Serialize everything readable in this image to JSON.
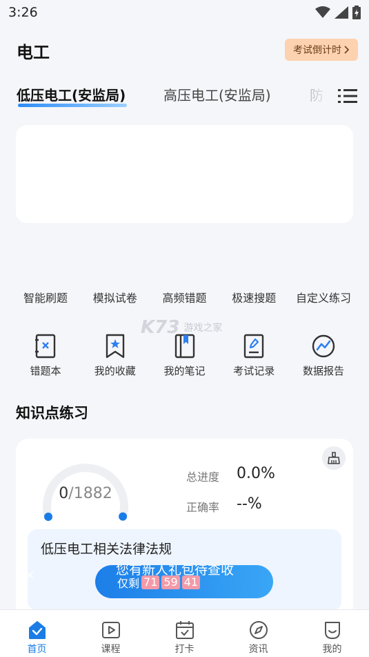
{
  "status_bar": {
    "time": "3:26"
  },
  "header": {
    "title": "电工",
    "countdown_label": "考试倒计时"
  },
  "tabs": [
    {
      "label": "低压电工(安监局)",
      "active": true
    },
    {
      "label": "高压电工(安监局)",
      "active": false
    },
    {
      "label": "防",
      "active": false
    }
  ],
  "quick_actions": [
    "智能刷题",
    "模拟试卷",
    "高频错题",
    "极速搜题",
    "自定义练习"
  ],
  "tools": [
    {
      "label": "错题本",
      "icon": "wrong-book-icon"
    },
    {
      "label": "我的收藏",
      "icon": "bookmark-icon"
    },
    {
      "label": "我的笔记",
      "icon": "notebook-icon"
    },
    {
      "label": "考试记录",
      "icon": "exam-record-icon"
    },
    {
      "label": "数据报告",
      "icon": "data-report-icon"
    }
  ],
  "watermark": {
    "brand": "K73",
    "text": "游戏之家"
  },
  "knowledge": {
    "section_title": "知识点练习",
    "done": "0",
    "total": "/1882",
    "progress_label": "总进度",
    "progress_value": "0.0%",
    "progress_fraction": 0,
    "accuracy_label": "正确率",
    "accuracy_value": "--%",
    "chapter_title": "低压电工相关法律法规"
  },
  "promo": {
    "title": "您有新人礼包待查收",
    "prefix": "仅剩",
    "hours": "71",
    "minutes": "59",
    "seconds": "41",
    "close": "×"
  },
  "bottom_nav": [
    {
      "label": "首页",
      "active": true
    },
    {
      "label": "课程",
      "active": false
    },
    {
      "label": "打卡",
      "active": false
    },
    {
      "label": "资讯",
      "active": false
    },
    {
      "label": "我的",
      "active": false
    }
  ],
  "colors": {
    "accent": "#1a7de6",
    "countdown_bg": "#fcd2b0",
    "countdown_text": "#6b3b16",
    "badge": "#f39aa8"
  }
}
